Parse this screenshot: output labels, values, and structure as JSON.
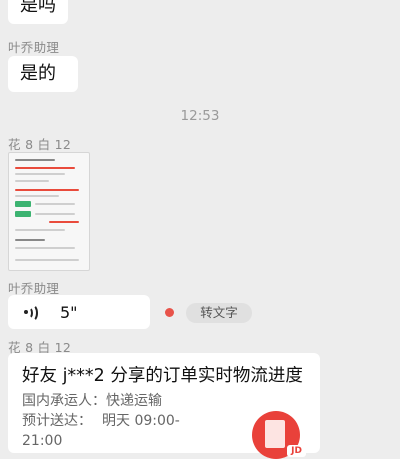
{
  "messages": {
    "msg1": {
      "text": "是吗"
    },
    "msg2": {
      "sender": "叶乔助理",
      "text": "是的"
    },
    "timestamp": "12:53",
    "msg3": {
      "sender": "花 8 白 12"
    },
    "msg4": {
      "sender": "叶乔助理",
      "duration": "5\"",
      "transcribe_label": "转文字"
    },
    "msg5": {
      "sender": "花 8 白 12",
      "card": {
        "title": "好友 j***2 分享的订单实时物流进度",
        "carrier_label": "国内承运人：",
        "carrier_value": "快递运输",
        "eta_label": "预计送达：",
        "eta_value": "明天 09:00-",
        "eta_value_2": "21:00",
        "thumb_badge": "JD"
      }
    }
  },
  "colors": {
    "background": "#ededed",
    "bubble": "#ffffff",
    "unread": "#e8534a",
    "brand_red": "#e9413a"
  }
}
